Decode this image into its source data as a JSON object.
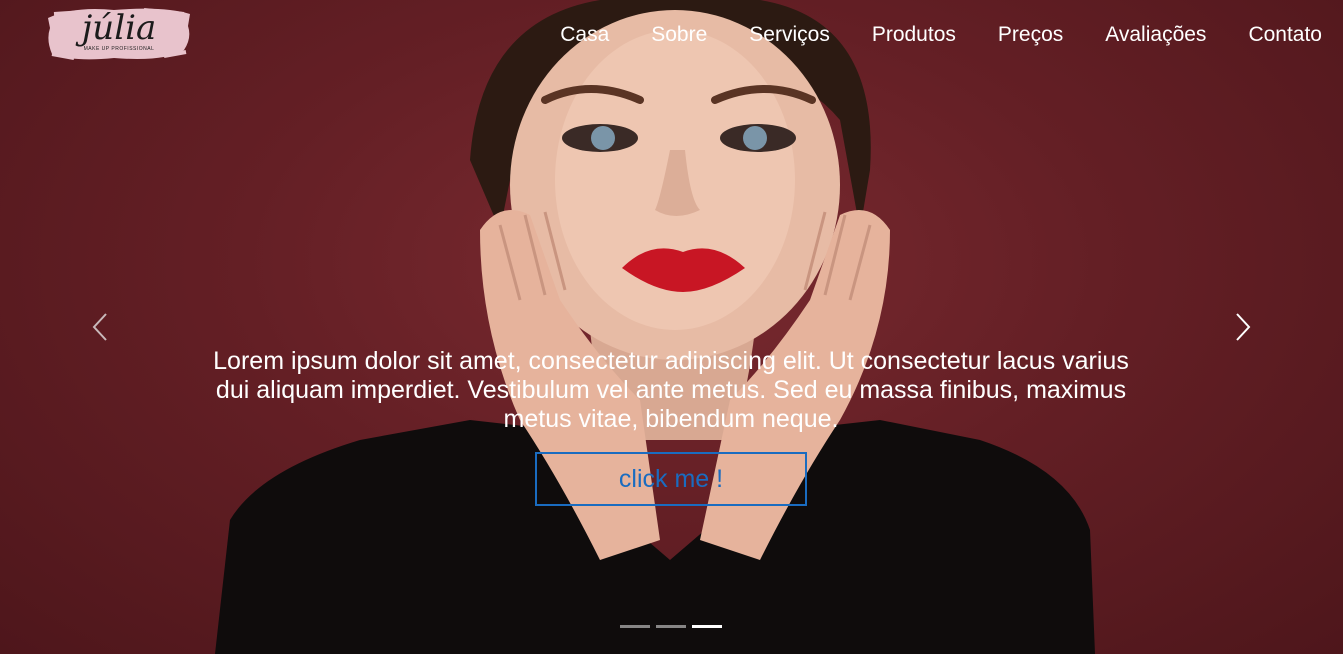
{
  "brand": {
    "name": "júlia",
    "tagline": "MAKE UP PROFISSIONAL",
    "swatch_color": "#e8c3cc"
  },
  "nav": {
    "items": [
      {
        "label": "Casa"
      },
      {
        "label": "Sobre"
      },
      {
        "label": "Serviços"
      },
      {
        "label": "Produtos"
      },
      {
        "label": "Preços"
      },
      {
        "label": "Avaliações"
      },
      {
        "label": "Contato"
      }
    ]
  },
  "carousel": {
    "caption": "Lorem ipsum dolor sit amet, consectetur adipiscing elit. Ut consectetur lacus varius dui aliquam imperdiet. Vestibulum vel ante metus. Sed eu massa finibus, maximus metus vitae, bibendum neque.",
    "button_label": "click me !",
    "prev_icon": "chevron-left-icon",
    "next_icon": "chevron-right-icon",
    "slide_count": 3,
    "active_slide": 3
  },
  "colors": {
    "background": "#5e1c22",
    "accent": "#1a6cc0",
    "text": "#ffffff"
  }
}
